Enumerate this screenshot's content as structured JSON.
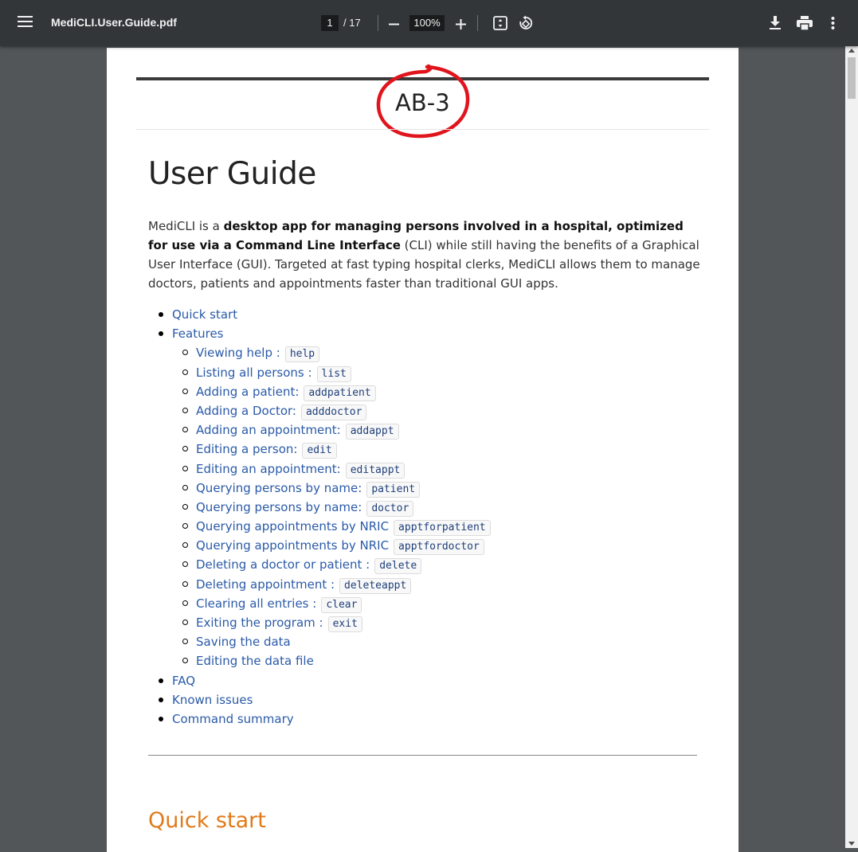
{
  "toolbar": {
    "title": "MediCLI.User.Guide.pdf",
    "page_current": "1",
    "page_total": "/ 17",
    "zoom": "100%"
  },
  "document": {
    "team_label": "AB-3",
    "heading": "User Guide",
    "intro": {
      "p1": "MediCLI is a ",
      "bold1": "desktop app for managing persons involved in a hospital, optimized for use via a Command Line Interface",
      "p2": " (CLI) while still having the benefits of a Graphical User Interface (GUI). Targeted at fast typing hospital clerks, MediCLI allows them to manage doctors, patients and appointments faster than traditional GUI apps."
    },
    "toc": [
      {
        "level": 1,
        "label": "Quick start",
        "code": ""
      },
      {
        "level": 1,
        "label": "Features",
        "code": ""
      },
      {
        "level": 2,
        "label": "Viewing help :",
        "code": "help"
      },
      {
        "level": 2,
        "label": "Listing all persons :",
        "code": "list"
      },
      {
        "level": 2,
        "label": "Adding a patient:",
        "code": "addpatient"
      },
      {
        "level": 2,
        "label": "Adding a Doctor:",
        "code": "adddoctor"
      },
      {
        "level": 2,
        "label": "Adding an appointment:",
        "code": "addappt"
      },
      {
        "level": 2,
        "label": "Editing a person:",
        "code": "edit"
      },
      {
        "level": 2,
        "label": "Editing an appointment:",
        "code": "editappt"
      },
      {
        "level": 2,
        "label": "Querying persons by name:",
        "code": "patient"
      },
      {
        "level": 2,
        "label": "Querying persons by name:",
        "code": "doctor"
      },
      {
        "level": 2,
        "label": "Querying appointments by NRIC",
        "code": "apptforpatient"
      },
      {
        "level": 2,
        "label": "Querying appointments by NRIC",
        "code": "apptfordoctor"
      },
      {
        "level": 2,
        "label": "Deleting a doctor or patient :",
        "code": "delete"
      },
      {
        "level": 2,
        "label": "Deleting appointment :",
        "code": "deleteappt"
      },
      {
        "level": 2,
        "label": "Clearing all entries :",
        "code": "clear"
      },
      {
        "level": 2,
        "label": "Exiting the program :",
        "code": "exit"
      },
      {
        "level": 2,
        "label": "Saving the data",
        "code": ""
      },
      {
        "level": 2,
        "label": "Editing the data file",
        "code": ""
      },
      {
        "level": 1,
        "label": "FAQ",
        "code": ""
      },
      {
        "level": 1,
        "label": "Known issues",
        "code": ""
      },
      {
        "level": 1,
        "label": "Command summary",
        "code": ""
      }
    ],
    "section_heading": "Quick start"
  },
  "icons": {
    "menu": "menu-icon",
    "zoom_out": "minus-icon",
    "zoom_in": "plus-icon",
    "fit": "fit-page-icon",
    "rotate": "rotate-icon",
    "download": "download-icon",
    "print": "print-icon",
    "more": "more-vert-icon"
  },
  "colors": {
    "toolbar_bg": "#323639",
    "viewer_bg": "#525659",
    "link": "#2a5aa8",
    "section_heading": "#e07a1a",
    "annotation": "#e0141c"
  }
}
